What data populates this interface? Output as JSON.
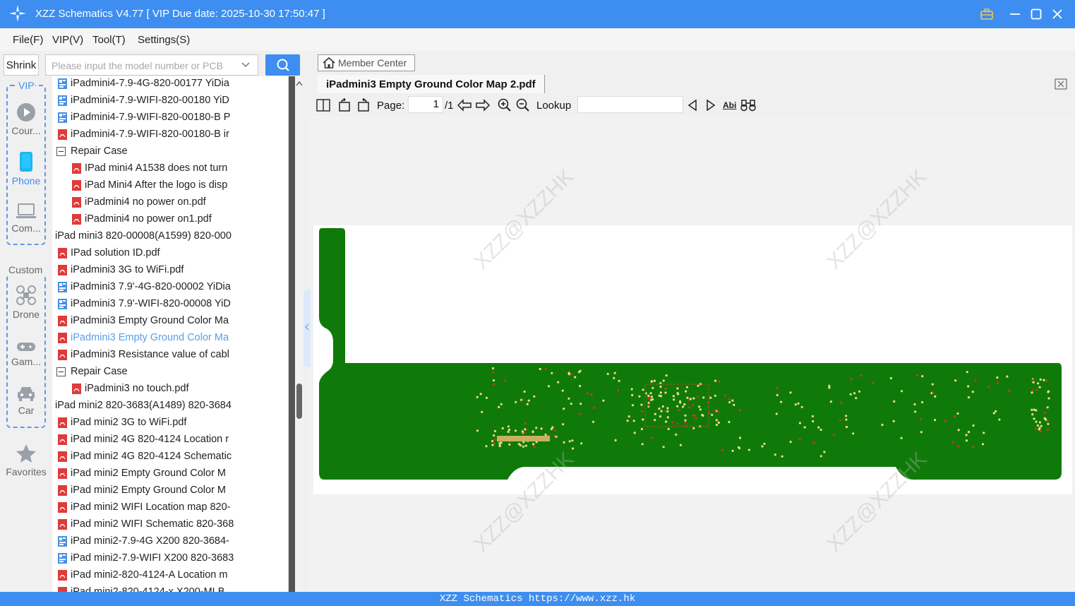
{
  "window": {
    "title": "XZZ Schematics V4.77 [ VIP Due date: 2025-10-30 17:50:47 ]",
    "accent": "#3d8ef0"
  },
  "menu": [
    "File(F)",
    "VIP(V)",
    "Tool(T)",
    "Settings(S)"
  ],
  "toolbar_left": {
    "shrink_label": "Shrink",
    "search_placeholder": "Please input the model number or PCB"
  },
  "categories": {
    "vip_label": "VIP",
    "custom_label": "Custom",
    "items": [
      {
        "label": "Cour...",
        "icon": "play-circle-icon",
        "active": false
      },
      {
        "label": "Phone",
        "icon": "phone-icon",
        "active": true
      },
      {
        "label": "Com...",
        "icon": "laptop-icon",
        "active": false
      },
      {
        "label": "Drone",
        "icon": "drone-icon",
        "active": false
      },
      {
        "label": "Gam...",
        "icon": "gamepad-icon",
        "active": false
      },
      {
        "label": "Car",
        "icon": "car-icon",
        "active": false
      },
      {
        "label": "Favorites",
        "icon": "star-icon",
        "active": false
      }
    ]
  },
  "tree": [
    {
      "label": "iPadmini4-7.9-4G-820-00177 YiDia",
      "type": "board",
      "level": 2
    },
    {
      "label": "iPadmini4-7.9-WIFI-820-00180 YiD",
      "type": "board",
      "level": 2
    },
    {
      "label": "iPadmini4-7.9-WIFI-820-00180-B P",
      "type": "board",
      "level": 2
    },
    {
      "label": "iPadmini4-7.9-WIFI-820-00180-B ir",
      "type": "pdf",
      "level": 2
    },
    {
      "label": "Repair Case",
      "type": "folder",
      "level": 2
    },
    {
      "label": "IPad mini4 A1538 does not turn",
      "type": "pdf",
      "level": 3
    },
    {
      "label": "iPad Mini4 After the logo is disp",
      "type": "pdf",
      "level": 3
    },
    {
      "label": "iPadmini4 no power on.pdf",
      "type": "pdf",
      "level": 3
    },
    {
      "label": "iPadmini4 no power on1.pdf",
      "type": "pdf",
      "level": 3
    },
    {
      "label": "iPad mini3 820-00008(A1599) 820-000",
      "type": "folder",
      "level": 1
    },
    {
      "label": "IPad solution ID.pdf",
      "type": "pdf",
      "level": 2
    },
    {
      "label": "iPadmini3 3G to WiFi.pdf",
      "type": "pdf",
      "level": 2
    },
    {
      "label": "iPadmini3 7.9'-4G-820-00002 YiDia",
      "type": "board",
      "level": 2
    },
    {
      "label": "iPadmini3 7.9'-WIFI-820-00008 YiD",
      "type": "board",
      "level": 2
    },
    {
      "label": "iPadmini3 Empty Ground Color Ma",
      "type": "pdf",
      "level": 2
    },
    {
      "label": "iPadmini3 Empty Ground Color Ma",
      "type": "pdf",
      "level": 2,
      "selected": true
    },
    {
      "label": "iPadmini3 Resistance value of cabl",
      "type": "pdf",
      "level": 2
    },
    {
      "label": "Repair Case",
      "type": "folder",
      "level": 2
    },
    {
      "label": "iPadmini3 no touch.pdf",
      "type": "pdf",
      "level": 3
    },
    {
      "label": "iPad mini2 820-3683(A1489) 820-3684",
      "type": "folder",
      "level": 1
    },
    {
      "label": "iPad mini2 3G to WiFi.pdf",
      "type": "pdf",
      "level": 2
    },
    {
      "label": "iPad mini2 4G 820-4124 Location r",
      "type": "pdf",
      "level": 2
    },
    {
      "label": "iPad mini2 4G 820-4124 Schematic",
      "type": "pdf",
      "level": 2
    },
    {
      "label": "iPad mini2 Empty Ground Color M",
      "type": "pdf",
      "level": 2
    },
    {
      "label": "iPad mini2 Empty Ground Color M",
      "type": "pdf",
      "level": 2
    },
    {
      "label": "iPad mini2 WIFI Location map 820-",
      "type": "pdf",
      "level": 2
    },
    {
      "label": "iPad mini2 WIFI Schematic 820-368",
      "type": "pdf",
      "level": 2
    },
    {
      "label": "iPad mini2-7.9-4G X200 820-3684-",
      "type": "board",
      "level": 2
    },
    {
      "label": "iPad mini2-7.9-WIFI X200 820-3683",
      "type": "board",
      "level": 2
    },
    {
      "label": "iPad mini2-820-4124-A Location m",
      "type": "pdf",
      "level": 2
    },
    {
      "label": "iPad mini2-820-4124-x X200-MLB",
      "type": "pdf",
      "level": 2
    }
  ],
  "viewer": {
    "member_center": "Member Center",
    "doc_tab": "iPadmini3 Empty Ground Color Map 2.pdf",
    "page_label": "Page:",
    "page_current": "1",
    "page_total": "/1",
    "lookup_label": "Lookup",
    "lookup_value": "",
    "abi_label": "Abi",
    "board_color": "#0f7a0a",
    "watermark": "XZZ@XZZHK"
  },
  "status": {
    "text": "XZZ Schematics https://www.xzz.hk"
  }
}
